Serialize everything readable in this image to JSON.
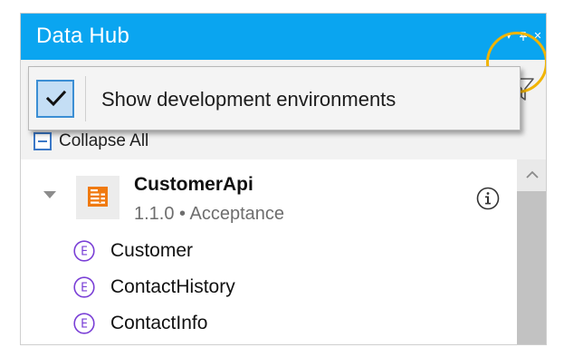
{
  "window": {
    "title": "Data Hub",
    "controls": [
      "▾",
      "ᵩ",
      "×"
    ]
  },
  "toolbar": {
    "search_value": "",
    "filter_icon": "filter-icon",
    "collapse_all_label": "Collapse All"
  },
  "filter_menu": {
    "items": [
      {
        "label": "Show development environments",
        "checked": true
      }
    ]
  },
  "tree": {
    "api": {
      "name": "CustomerApi",
      "version": "1.1.0",
      "separator": "•",
      "environment": "Acceptance",
      "meta": "1.1.0 • Acceptance",
      "icon": "document-icon",
      "expanded": true
    },
    "entities": [
      {
        "label": "Customer",
        "icon_letter": "E"
      },
      {
        "label": "ContactHistory",
        "icon_letter": "E"
      },
      {
        "label": "ContactInfo",
        "icon_letter": "E"
      }
    ]
  },
  "colors": {
    "title_bar": "#0aa5f0",
    "highlight_ring": "#f1b400",
    "checkbox_fill": "#c4def5",
    "entity_icon": "#7a3fd6",
    "api_icon": "#f07a10"
  }
}
